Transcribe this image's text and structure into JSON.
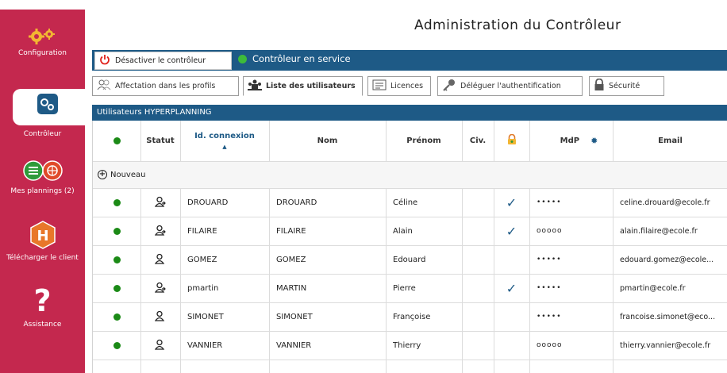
{
  "title": "Administration du Contrôleur",
  "sidebar": {
    "items": [
      {
        "label": "Configuration",
        "icon": "gears-icon"
      },
      {
        "label": "Contrôleur",
        "icon": "controller-icon",
        "active": true
      },
      {
        "label": "Mes plannings (2)",
        "icon": "plannings-icon"
      },
      {
        "label": "Télécharger le client",
        "icon": "hyperplanning-h-icon"
      },
      {
        "label": "Assistance",
        "icon": "question-icon"
      }
    ]
  },
  "toolbar": {
    "deactivate_label": "Désactiver le contrôleur",
    "status_label": "Contrôleur en service"
  },
  "tabs": [
    {
      "label": "Affectation dans les profils",
      "icon": "users-profile-icon"
    },
    {
      "label": "Liste des utilisateurs",
      "icon": "users-list-icon",
      "active": true
    },
    {
      "label": "Licences",
      "icon": "licence-icon"
    },
    {
      "label": "Déléguer l'authentification",
      "icon": "key-icon"
    },
    {
      "label": "Sécurité",
      "icon": "lock-icon"
    }
  ],
  "section_title": "Utilisateurs HYPERPLANNING",
  "table": {
    "columns": [
      "",
      "Statut",
      "Id. connexion",
      "Nom",
      "Prénom",
      "Civ.",
      "",
      "MdP",
      "Email"
    ],
    "sorted_column": "Id. connexion",
    "new_label": "Nouveau",
    "rows": [
      {
        "status": "user-arrow",
        "id": "DROUARD",
        "nom": "DROUARD",
        "prenom": "Céline",
        "civ": "",
        "checked": true,
        "mdp": "•••••",
        "email": "celine.drouard@ecole.fr"
      },
      {
        "status": "user-arrow",
        "id": "FILAIRE",
        "nom": "FILAIRE",
        "prenom": "Alain",
        "civ": "",
        "checked": true,
        "mdp": "ooooo",
        "email": "alain.filaire@ecole.fr"
      },
      {
        "status": "user",
        "id": "GOMEZ",
        "nom": "GOMEZ",
        "prenom": "Edouard",
        "civ": "",
        "checked": false,
        "mdp": "•••••",
        "email": "edouard.gomez@ecole..."
      },
      {
        "status": "user-arrow",
        "id": "pmartin",
        "nom": "MARTIN",
        "prenom": "Pierre",
        "civ": "",
        "checked": true,
        "mdp": "•••••",
        "email": "pmartin@ecole.fr"
      },
      {
        "status": "user",
        "id": "SIMONET",
        "nom": "SIMONET",
        "prenom": "Françoise",
        "civ": "",
        "checked": false,
        "mdp": "•••••",
        "email": "francoise.simonet@eco..."
      },
      {
        "status": "user",
        "id": "VANNIER",
        "nom": "VANNIER",
        "prenom": "Thierry",
        "civ": "",
        "checked": false,
        "mdp": "ooooo",
        "email": "thierry.vannier@ecole.fr"
      }
    ]
  },
  "colors": {
    "sidebar": "#c4284e",
    "bar": "#1e5a86",
    "dot": "#1b8a16"
  }
}
